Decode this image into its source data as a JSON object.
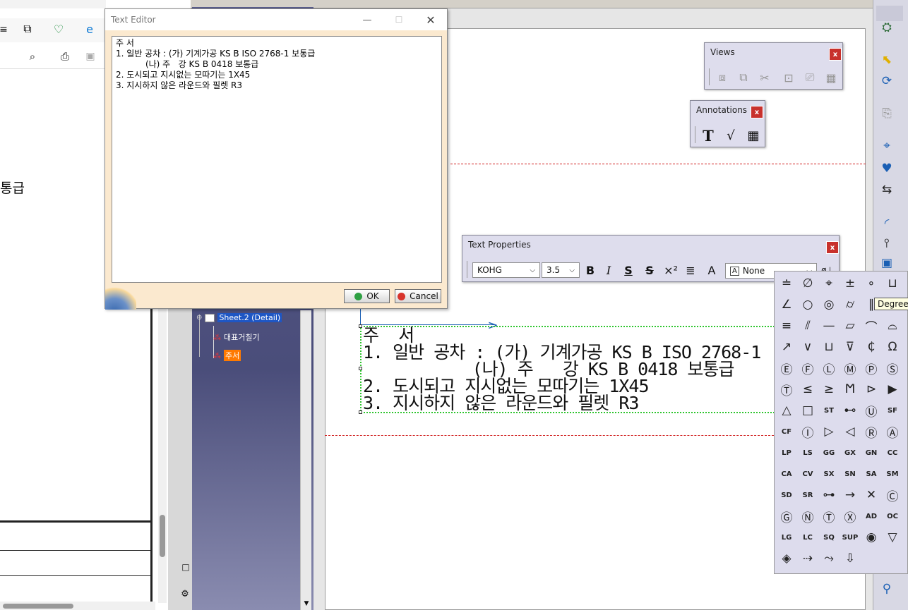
{
  "browser": {
    "snippet_text": "통급"
  },
  "tree": {
    "sheet_label": "Sheet.2 (Detail)",
    "children": [
      {
        "label": "대표거칠기"
      },
      {
        "label": "주서"
      }
    ]
  },
  "text_editor": {
    "title": "Text Editor",
    "content": "주 서\n1. 일반 공차 : (가) 기계가공 KS B ISO 2768-1 보통급\n           (나) 주   강 KS B 0418 보통급\n2. 도시되고 지시없는 모따기는 1X45\n3. 지시하지 않은 라운드와 필렛 R3",
    "ok_label": "OK",
    "cancel_label": "Cancel"
  },
  "views_toolbar": {
    "title": "Views"
  },
  "annotations_toolbar": {
    "title": "Annotations"
  },
  "text_properties": {
    "title": "Text Properties",
    "font": "KOHG",
    "size": "3.5",
    "frame_option": "None"
  },
  "drawing_text": {
    "lines": [
      "주  서",
      "1. 일반 공차 : (가) 기계가공 KS B ISO 2768-1",
      "           (나) 주   강 KS B 0418 보통급",
      "2. 도시되고 지시없는 모따기는 1X45",
      "3. 지시하지 않은 라운드와 필렛 R3"
    ]
  },
  "tooltip": {
    "text": "Degree"
  },
  "colors": {
    "accent_red": "#c8312c",
    "selection_green": "#2ec52e",
    "tree_bg": "#4a4d7a",
    "editor_bg": "#fbe9cf"
  },
  "palette_symbols": [
    "≐",
    "∅",
    "⌖",
    "±",
    "∘",
    "⊔",
    "∠",
    "○",
    "◎",
    "⌭",
    "∥",
    "⟂",
    "≡",
    "⫽",
    "—",
    "▱",
    "⌒",
    "⌓",
    "↗",
    "∨",
    "⊔",
    "⊽",
    "₵",
    "Ω",
    "Ⓔ",
    "Ⓕ",
    "Ⓛ",
    "Ⓜ",
    "Ⓟ",
    "Ⓢ",
    "Ⓣ",
    "≤",
    "≥",
    "Ϻ",
    "⊳",
    "▶",
    "△",
    "□",
    "ST",
    "⊷",
    "Ⓤ",
    "SF",
    "CF",
    "Ⓘ",
    "▷",
    "◁",
    "Ⓡ",
    "Ⓐ",
    "LP",
    "LS",
    "GG",
    "GX",
    "GN",
    "CC",
    "CA",
    "CV",
    "SX",
    "SN",
    "SA",
    "SM",
    "SD",
    "SR",
    "⊶",
    "→",
    "✕",
    "Ⓒ",
    "Ⓖ",
    "Ⓝ",
    "Ⓣ",
    "Ⓧ",
    "AD",
    "OC",
    "LG",
    "LC",
    "SQ",
    "SUP",
    "◉",
    "▽",
    "◈",
    "⇢",
    "⤳",
    "⇩"
  ]
}
